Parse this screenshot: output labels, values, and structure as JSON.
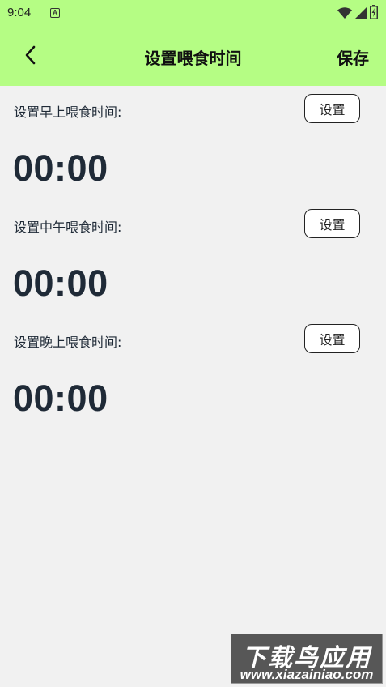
{
  "status_bar": {
    "time": "9:04",
    "app_icon_letter": "A"
  },
  "header": {
    "title": "设置喂食时间",
    "save_label": "保存",
    "background_color": "#b5fd84"
  },
  "sections": [
    {
      "label": "设置早上喂食时间:",
      "button_label": "设置",
      "time": "00:00"
    },
    {
      "label": "设置中午喂食时间:",
      "button_label": "设置",
      "time": "00:00"
    },
    {
      "label": "设置晚上喂食时间:",
      "button_label": "设置",
      "time": "00:00"
    }
  ],
  "watermark": {
    "top_text": "下载鸟应用",
    "bottom_text": "www.xiazainiao.com"
  }
}
